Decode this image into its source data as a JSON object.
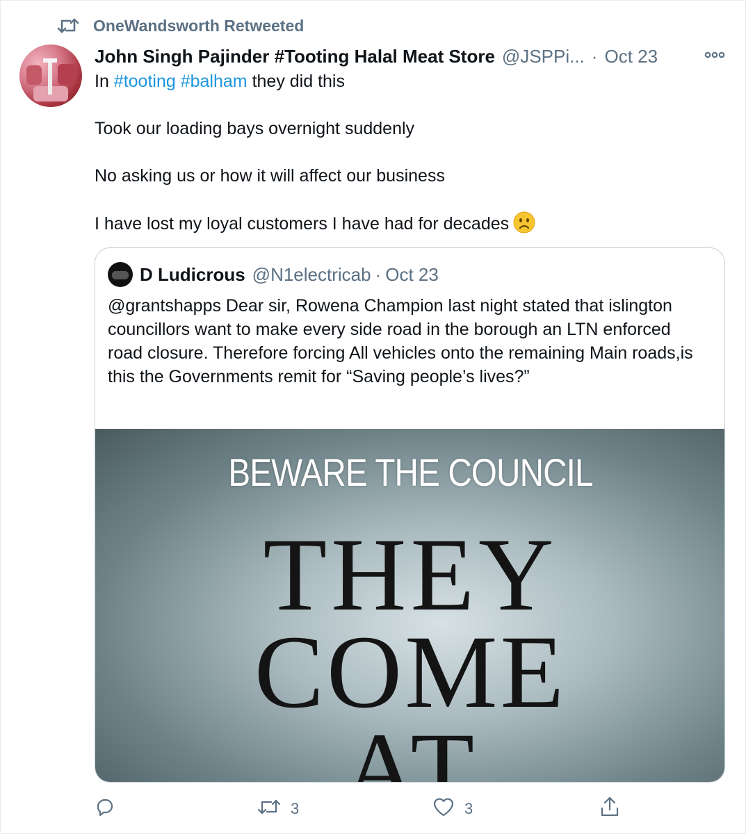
{
  "social_context": {
    "text": "OneWandsworth Retweeted"
  },
  "tweet": {
    "author_name": "John Singh Pajinder #Tooting Halal Meat Store",
    "author_handle": "@JSPPi...",
    "separator": "·",
    "time": "Oct 23",
    "body": {
      "line1_prefix": "In ",
      "hashtag1": "#tooting",
      "hashtag2": "#balham",
      "line1_suffix": " they did this",
      "para2": "Took our loading bays overnight suddenly",
      "para3": "No asking us or how it will affect our business",
      "para4": "I have lost my loyal customers I have had for decades"
    },
    "emoji": "slightly-frowning-face",
    "actions": {
      "reply_count": "",
      "retweet_count": "3",
      "like_count": "3"
    }
  },
  "quoted_tweet": {
    "author_name": "D Ludicrous",
    "author_handle": "@N1electricab",
    "separator": "·",
    "time": "Oct 23",
    "text": "@grantshapps Dear sir, Rowena Champion last night stated that islington councillors want to make every side road in the borough an LTN enforced road closure. Therefore forcing All vehicles onto the remaining Main roads,is this the Governments remit for “Saving people’s lives?”",
    "image_text": {
      "line1": "BEWARE THE COUNCIL",
      "line2": "THEY",
      "line3": "COME",
      "line4": "AT"
    }
  },
  "colors": {
    "link": "#1b95e0",
    "muted": "#5b7083",
    "text": "#0f1419",
    "border": "#c4cfd6"
  }
}
